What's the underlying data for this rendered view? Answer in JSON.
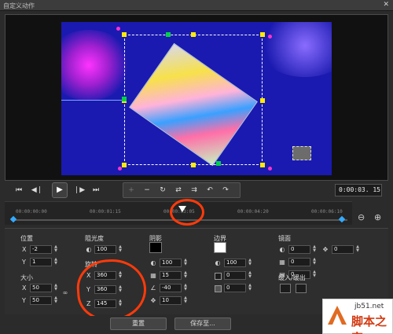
{
  "window": {
    "title": "自定义动作",
    "close_glyph": "✕"
  },
  "transport": {
    "timecode": "0:00:03. 15",
    "icons": [
      "skip-start-icon",
      "step-back-icon",
      "play-icon",
      "step-forward-icon",
      "skip-end-icon"
    ]
  },
  "toolbar": {
    "icons": [
      "add-keyframe-icon",
      "remove-keyframe-icon",
      "reverse-icon",
      "move-left-icon",
      "move-right-icon",
      "goto-prev-icon",
      "goto-next-icon"
    ]
  },
  "timeline": {
    "ticks": [
      "00:00:00:00",
      "00:00:01:15",
      "00:00:03:05",
      "00:00:04:20",
      "00:00:06:10"
    ]
  },
  "position": {
    "label": "位置",
    "x": "-2",
    "y": "1"
  },
  "size": {
    "label": "大小",
    "x": "50",
    "y": "50"
  },
  "opacity": {
    "label": "阻光度",
    "value": "100"
  },
  "rotation": {
    "label": "旋转",
    "x": "360",
    "y": "360",
    "z": "145"
  },
  "shadow": {
    "label": "阴影",
    "values": [
      "100",
      "15",
      "-40",
      "10"
    ],
    "color": "#000000"
  },
  "border": {
    "label": "边界",
    "values": [
      "100",
      "0",
      "0"
    ],
    "color": "#ffffff"
  },
  "mirror": {
    "label": "镜面",
    "values": [
      "0",
      "0",
      "0"
    ],
    "pan_value": "0"
  },
  "ease": {
    "label": "缓入/缓出"
  },
  "footer": {
    "reset": "重置",
    "save_as": "保存至..."
  },
  "watermark": {
    "site": "jb51.net",
    "brand": "脚本之家"
  },
  "colors": {
    "annotation": "#ff3a0a",
    "preview_bg": "#1a1ab0",
    "handle_yellow": "#ffeb00",
    "handle_green": "#00d14a"
  }
}
